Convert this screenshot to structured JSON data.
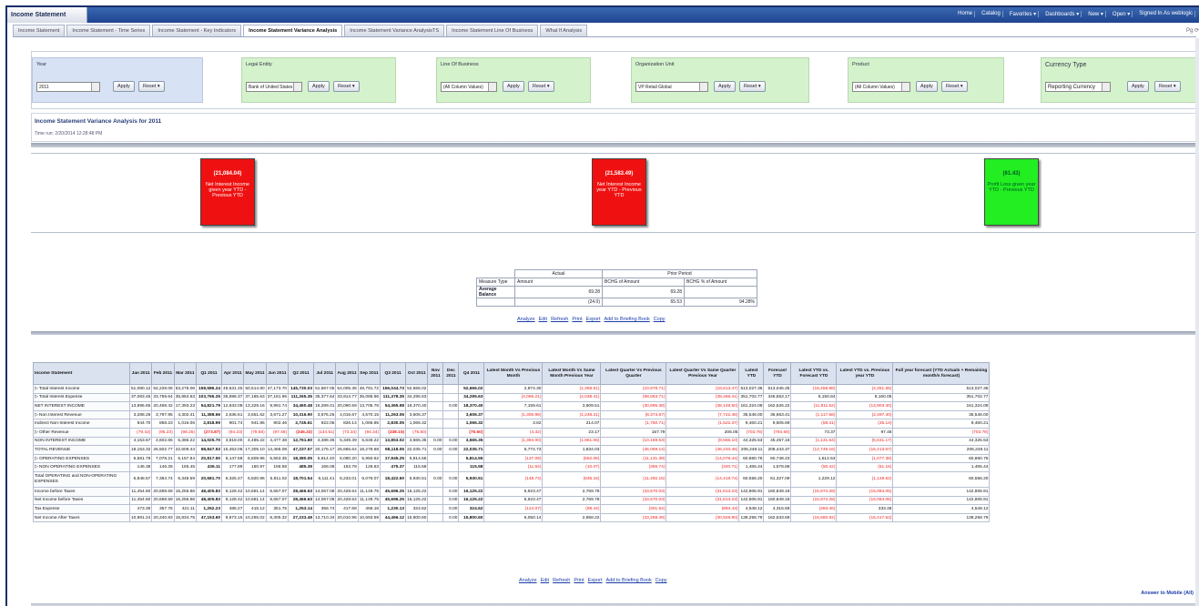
{
  "app": {
    "title": "Income Statement"
  },
  "nav": [
    "Home",
    "Catalog",
    "Favorites ▾",
    "Dashboards ▾",
    "New ▾",
    "Open ▾",
    "Signed In As  weblogic"
  ],
  "tabs": [
    {
      "label": "Income Statement",
      "active": false
    },
    {
      "label": "Income Statement - Time Series",
      "active": false
    },
    {
      "label": "Income Statement - Key Indicators",
      "active": false
    },
    {
      "label": "Income Statement Variance Analysis",
      "active": true
    },
    {
      "label": "Income Statement Variance AnalysisTS",
      "active": false
    },
    {
      "label": "Income Statement Line Of Business",
      "active": false
    },
    {
      "label": "What If Analysis",
      "active": false
    }
  ],
  "page_icon": "Pg ⟳",
  "prompts": [
    {
      "label": "Year",
      "value": "2011",
      "apply": "Apply",
      "reset": "Reset ▾",
      "color": "blue"
    },
    {
      "label": "Legal Entity",
      "value": "Bank of United States",
      "apply": "Apply",
      "reset": "Reset ▾",
      "color": "green"
    },
    {
      "label": "Line Of Business",
      "value": "(All Column Values)",
      "apply": "Apply",
      "reset": "Reset ▾",
      "color": "green"
    },
    {
      "label": "Organization Unit",
      "value": "VP Retail Global",
      "apply": "Apply",
      "reset": "Reset ▾",
      "color": "green"
    },
    {
      "label": "Product",
      "value": "(All Column Values)",
      "apply": "Apply",
      "reset": "Reset ▾",
      "color": "green"
    },
    {
      "label": "Currency Type",
      "value": "Reporting Currency",
      "apply": "Apply",
      "reset": "Reset ▾",
      "color": "green"
    }
  ],
  "section": {
    "title": "Income Statement Variance Analysis for 2011",
    "time_run": "Time run: 2/20/2014 12:28:48 PM"
  },
  "kpis": [
    {
      "value": "(21,084.04)",
      "text": "Net Interest Income given year YTD - Previous YTD",
      "color": "red"
    },
    {
      "value": "(21,583.49)",
      "text": "Net Interest Income year YTD - Previous YTD",
      "color": "red"
    },
    {
      "value": "(61.43)",
      "text": "Profit Loss given year YTD - Previous YTD",
      "color": "green"
    }
  ],
  "pivot": {
    "hdr_actual": "Actual",
    "hdr_prior": "Prior Period",
    "measure_type": "Measure Type",
    "amount": "Amount",
    "chg_amount": "BCHG of Amount",
    "chg_pct": "BCHG % of Amount",
    "row1_label": "Average Balance",
    "row1_vals": [
      "69.28",
      "69.28",
      ""
    ],
    "row2_label": "",
    "row2_vals": [
      "(24.0)",
      "65.53",
      "94.28%"
    ]
  },
  "links_top": [
    "Analyze",
    "Edit",
    "Refresh",
    "Print",
    "Export",
    "Add to Briefing Book",
    "Copy"
  ],
  "links_bottom": [
    "Analyze",
    "Edit",
    "Refresh",
    "Print",
    "Export",
    "Add to Briefing Book",
    "Copy"
  ],
  "footer_link": "Answer to Mobile (All)",
  "table": {
    "headers": [
      "Income Statement",
      "Jan 2011",
      "Feb 2011",
      "Mar 2011",
      "Q1 2011",
      "Apr 2011",
      "May 2011",
      "Jun 2011",
      "Q2 2011",
      "Jul 2011",
      "Aug 2011",
      "Sep 2011",
      "Q3 2011",
      "Oct 2011",
      "Nov 2011",
      "Dec 2011",
      "Q4 2011",
      "Latest Month Vs Previous Month",
      "Latest Month Vs Same Month Previous Year",
      "Latest Quarter Vs Previous Quarter",
      "Latest Quarter Vs Same Quarter Previous Year",
      "Latest YTD",
      "Forecast YTD",
      "Latest YTD vs. Forecast YTD",
      "Latest YTD vs. Previous year YTD",
      "Full year forecast (YTD Actuals + Remaining month/s forecast)"
    ],
    "rows": [
      [
        "▷ Total Interest Income",
        "51,080.12",
        "54,228.06",
        "53,278.06",
        "158,586.24",
        "48,531.45",
        "50,514.80",
        "47,173.70",
        "145,730.03",
        "51,667.05",
        "54,005.36",
        "48,791.72",
        "156,044.73",
        "52,666.02",
        "",
        "",
        "52,666.02",
        "2,874.30",
        "(1,368.61)",
        "(10,978.71)",
        "(18,613.47)",
        "513,027.36",
        "513,046.25",
        "(18,458.88)",
        "(4,451.65)",
        "513,027.36"
      ],
      [
        "▷ Total Interest Expense",
        "37,083.46",
        "33,759.64",
        "35,864.63",
        "103,765.25",
        "35,898.37",
        "37,185.63",
        "37,181.96",
        "111,265.35",
        "35,377.64",
        "33,914.77",
        "35,085.96",
        "111,378.35",
        "34,295.63",
        "",
        "",
        "34,295.63",
        "(4,065.21)",
        "(4,038.41)",
        "(98,063.71)",
        "(38,466.41)",
        "351,702.77",
        "346,553.17",
        "5,150.84",
        "8,160.05",
        "351,702.77"
      ],
      [
        "NET INTEREST INCOME",
        "13,996.65",
        "20,468.42",
        "17,393.23",
        "54,821.79",
        "12,633.08",
        "13,329.16",
        "9,991.74",
        "34,460.48",
        "16,289.41",
        "20,090.59",
        "13,705.76",
        "54,365.98",
        "18,370.40",
        "",
        "0.00",
        "18,370.40",
        "7,159.61",
        "3,809.51",
        "(30,895.38)",
        "(38,148.50)",
        "161,324.09",
        "162,526.22",
        "(11,811.52)",
        "(13,903.40)",
        "161,324.09"
      ],
      [
        "▷ Non Interest Revenue",
        "3,288.28",
        "3,797.95",
        "4,302.41",
        "11,388.66",
        "2,636.61",
        "3,651.62",
        "3,671.27",
        "10,316.90",
        "3,676.25",
        "4,016.67",
        "4,570.15",
        "11,263.06",
        "3,606.37",
        "",
        "",
        "3,606.37",
        "(1,300.98)",
        "(1,248.21)",
        "(8,374.67)",
        "(7,722.46)",
        "35,546.00",
        "36,663.41",
        "(1,117.56)",
        "(2,497.40)",
        "35,546.00"
      ],
      [
        "Indirect Non-Interest Income",
        "944.70",
        "858.23",
        "1,016.06",
        "2,818.99",
        "901.74",
        "941.86",
        "902.46",
        "2,745.61",
        "922.06",
        "826.14",
        "1,066.85",
        "2,830.05",
        "1,066.32",
        "",
        "",
        "1,066.32",
        "3.62",
        "214.07",
        "(1,750.71)",
        "(1,522.37)",
        "9,460.21",
        "9,505.69",
        "(58.41)",
        "(25.14)",
        "9,460.21"
      ],
      [
        "▷ Other Revenue",
        "(79.42)",
        "(95.23)",
        "(98.25)",
        "(273.87)",
        "(94.23)",
        "(79.56)",
        "(97.48)",
        "(345.33)",
        "(134.51)",
        "(73.34)",
        "(94.34)",
        "(338.15)",
        "(75.50)",
        "",
        "",
        "(75.50)",
        "(4.32)",
        "23.17",
        "157.79",
        "206.05",
        "(703.78)",
        "(794.66)",
        "73.37",
        "97.48",
        "(703.78)"
      ],
      [
        "NON INTEREST INCOME",
        "4,153.67",
        "4,602.65",
        "5,366.22",
        "14,025.70",
        "3,818.00",
        "4,485.22",
        "4,477.38",
        "12,761.60",
        "4,489.36",
        "5,349.39",
        "5,648.22",
        "13,853.02",
        "3,665.35",
        "0.00",
        "0.00",
        "3,665.35",
        "(1,394.00)",
        "(1,961.06)",
        "(10,169.63)",
        "(9,565.10)",
        "44,325.53",
        "45,457.16",
        "(1,131.64)",
        "(5,631.17)",
        "44,325.53"
      ],
      [
        "TOTAL REVENUE",
        "18,153.32",
        "26,502.77",
        "22,609.44",
        "68,847.53",
        "15,453.06",
        "17,305.10",
        "14,468.08",
        "47,237.57",
        "20,176.17",
        "26,665.64",
        "18,278.68",
        "68,118.05",
        "22,035.71",
        "0.00",
        "0.00",
        "22,035.71",
        "5,774.73",
        "1,834.03",
        "(46,069.14)",
        "(46,233.46)",
        "206,248.11",
        "208,443.37",
        "(12,749.16)",
        "(16,213.67)",
        "206,248.11"
      ],
      [
        "▷ OPERATING EXPENSES",
        "6,581.79",
        "7,078.21",
        "6,157.84",
        "20,817.50",
        "6,147.58",
        "6,609.96",
        "5,553.35",
        "18,380.05",
        "5,614.40",
        "6,080.20",
        "5,950.62",
        "17,945.25",
        "5,814.55",
        "",
        "",
        "5,814.55",
        "(137.09)",
        "(552.06)",
        "(11,131.39)",
        "(14,078.44)",
        "60,860.76",
        "60,748.23",
        "1,512.53",
        "(1,077.38)",
        "60,860.76"
      ],
      [
        "▷ NON OPERATING EXPENSES",
        "146.38",
        "146.28",
        "165.45",
        "436.11",
        "177.89",
        "160.97",
        "168.59",
        "485.39",
        "166.06",
        "153.78",
        "126.63",
        "475.37",
        "115.58",
        "",
        "",
        "115.58",
        "(11.64)",
        "(10.07)",
        "(356.74)",
        "(340.71)",
        "1,465.44",
        "1,578.86",
        "(50.42)",
        "(51.16)",
        "1,465.44"
      ],
      [
        "Total OPERATING and NON-OPERATING EXPENSES",
        "6,848.57",
        "7,384.74",
        "6,348.59",
        "20,681.70",
        "6,325.47",
        "6,820.96",
        "5,811.02",
        "18,701.54",
        "6,111.41",
        "6,233.01",
        "6,076.07",
        "18,422.60",
        "5,930.51",
        "0.00",
        "0.00",
        "5,930.51",
        "(148.74)",
        "(835.16)",
        "(11,492.15)",
        "(14,419.74)",
        "60,556.20",
        "61,327.09",
        "1,229.12",
        "(1,128.62)",
        "60,556.20"
      ],
      [
        "Income before Taxes",
        "11,454.60",
        "20,698.59",
        "16,255.86",
        "48,405.83",
        "9,128.42",
        "10,681.14",
        "8,657.07",
        "28,466.63",
        "14,067.08",
        "20,428.64",
        "11,149.75",
        "45,696.25",
        "16,125.22",
        "",
        "0.00",
        "16,125.22",
        "5,923.47",
        "2,769.78",
        "(33,570.03)",
        "(31,813.23)",
        "142,806.91",
        "160,849.18",
        "(15,974.28)",
        "(15,084.05)",
        "142,806.91"
      ],
      [
        "Net Income before Taxes",
        "11,454.60",
        "20,698.59",
        "16,255.86",
        "48,405.83",
        "9,128.42",
        "10,681.14",
        "8,657.07",
        "28,466.63",
        "14,067.08",
        "20,428.64",
        "11,149.75",
        "45,696.25",
        "16,125.22",
        "",
        "0.00",
        "16,125.22",
        "5,923.47",
        "2,769.78",
        "(33,570.03)",
        "(31,813.23)",
        "142,806.91",
        "160,849.18",
        "(15,974.28)",
        "(15,084.05)",
        "142,806.91"
      ],
      [
        "Tax Expense",
        "473.36",
        "357.76",
        "421.11",
        "1,252.23",
        "485.27",
        "416.12",
        "351.75",
        "1,253.14",
        "356.74",
        "417.68",
        "456.16",
        "1,230.13",
        "324.62",
        "",
        "0.00",
        "324.62",
        "(124.07)",
        "(98.44)",
        "(301.54)",
        "(884.43)",
        "4,548.12",
        "4,316.59",
        "(393.46)",
        "333.48",
        "4,548.12"
      ],
      [
        "Net Income After Taxes",
        "10,981.24",
        "20,340.83",
        "15,834.75",
        "47,153.60",
        "8,673.15",
        "10,265.02",
        "8,305.32",
        "27,233.49",
        "13,710.34",
        "20,010.96",
        "10,693.59",
        "44,466.12",
        "15,800.60",
        "",
        "0.00",
        "15,800.60",
        "6,050.14",
        "2,858.22",
        "(33,268.49)",
        "(30,928.80)",
        "138,258.79",
        "162,533.69",
        "(15,580.82)",
        "(15,417.53)",
        "138,258.79"
      ]
    ]
  }
}
